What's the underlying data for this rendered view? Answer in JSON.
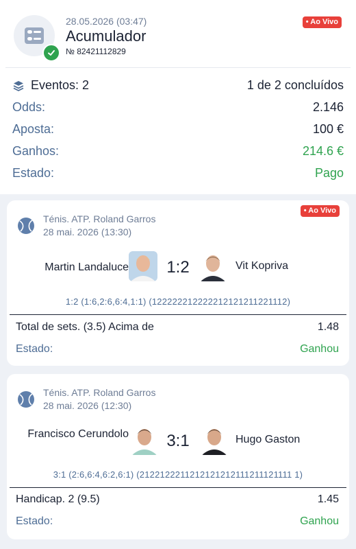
{
  "header": {
    "datetime": "28.05.2026 (03:47)",
    "title": "Acumulador",
    "ticket_number": "№ 82421112829",
    "live_badge": "• Ao Vivo"
  },
  "summary": {
    "events_label": "Eventos: 2",
    "events_progress": "1 de 2 concluídos",
    "odds_label": "Odds:",
    "odds_value": "2.146",
    "bet_label": "Aposta:",
    "bet_value": "100 €",
    "winnings_label": "Ganhos:",
    "winnings_value": "214.6 €",
    "status_label": "Estado:",
    "status_value": "Pago"
  },
  "events": [
    {
      "live_badge": "• Ao Vivo",
      "league": "Ténis. ATP. Roland Garros",
      "date": "28 mai. 2026 (13:30)",
      "player1": "Martin Landaluce",
      "player2": "Vit Kopriva",
      "score": "1:2",
      "score_detail": "1:2 (1:6,2:6,6:4,1:1) (122222212222212121211221112)",
      "market": "Total de sets. (3.5) Acima de",
      "odd": "1.48",
      "status_label": "Estado:",
      "status_value": "Ganhou"
    },
    {
      "league": "Ténis. ATP. Roland Garros",
      "date": "28 mai. 2026 (12:30)",
      "player1": "Francisco Cerundolo",
      "player2": "Hugo Gaston",
      "score": "3:1",
      "score_detail": "3:1 (2:6,6:4,6:2,6:1) (2122122211212121212111211121111 1)",
      "market": "Handicap. 2 (9.5)",
      "odd": "1.45",
      "status_label": "Estado:",
      "status_value": "Ganhou"
    }
  ],
  "colors": {
    "accent_green": "#2fa34f",
    "live_red": "#e8403a",
    "label_blue": "#4e6d95",
    "text_dark": "#1b2233",
    "background_gray": "#eef1f6"
  },
  "icons": [
    "ticket-icon",
    "check-icon",
    "layers-icon",
    "tennis-ball-icon"
  ]
}
